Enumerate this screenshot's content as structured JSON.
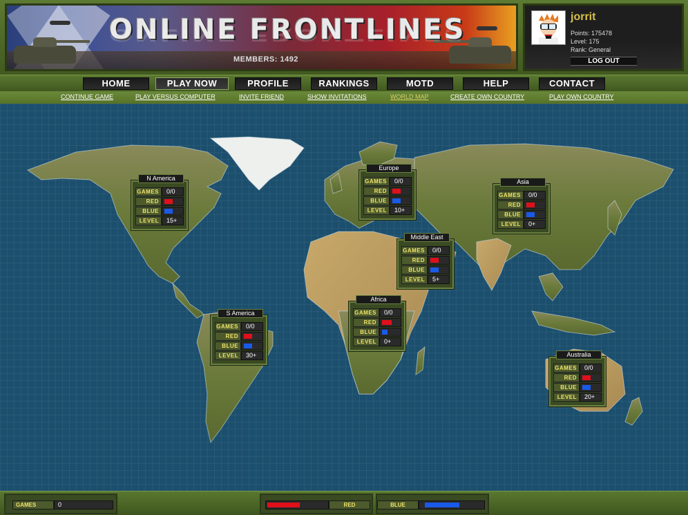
{
  "header": {
    "title": "ONLINE FRONTLINES",
    "members_label": "MEMBERS:",
    "members_count": "1492"
  },
  "user": {
    "name": "jorrit",
    "points": "Points: 175478",
    "level": "Level: 175",
    "rank": "Rank: General",
    "logout": "LOG OUT"
  },
  "nav": {
    "items": [
      {
        "label": "HOME"
      },
      {
        "label": "PLAY NOW",
        "active": true
      },
      {
        "label": "PROFILE"
      },
      {
        "label": "RANKINGS"
      },
      {
        "label": "MOTD"
      },
      {
        "label": "HELP"
      },
      {
        "label": "CONTACT"
      }
    ]
  },
  "subnav": {
    "items": [
      {
        "label": "CONTINUE GAME"
      },
      {
        "label": "PLAY VERSUS COMPUTER"
      },
      {
        "label": "INVITE FRIEND"
      },
      {
        "label": "SHOW INVITATIONS"
      },
      {
        "label": "WORLD MAP",
        "current": true
      },
      {
        "label": "CREATE OWN COUNTRY"
      },
      {
        "label": "PLAY OWN COUNTRY"
      }
    ]
  },
  "row_labels": {
    "games": "GAMES",
    "red": "RED",
    "blue": "BLUE",
    "level": "LEVEL"
  },
  "regions": [
    {
      "name": "N America",
      "games": "0/0",
      "red": 0.45,
      "blue": 0.45,
      "level": "15+"
    },
    {
      "name": "Europe",
      "games": "0/0",
      "red": 0.45,
      "blue": 0.45,
      "level": "10+"
    },
    {
      "name": "Asia",
      "games": "0/0",
      "red": 0.45,
      "blue": 0.45,
      "level": "0+"
    },
    {
      "name": "Middle East",
      "games": "0/0",
      "red": 0.45,
      "blue": 0.45,
      "level": "5+"
    },
    {
      "name": "Africa",
      "games": "0/0",
      "red": 0.55,
      "blue": 0.3,
      "level": "0+"
    },
    {
      "name": "S America",
      "games": "0/0",
      "red": 0.45,
      "blue": 0.45,
      "level": "30+"
    },
    {
      "name": "Australia",
      "games": "0/0",
      "red": 0.45,
      "blue": 0.45,
      "level": "20+"
    }
  ],
  "footer": {
    "games_label": "GAMES",
    "games_value": "0",
    "red_label": "RED",
    "red_fill": 0.55,
    "blue_label": "BLUE",
    "blue_fill": 0.55
  },
  "colors": {
    "red": "#e0101a",
    "blue": "#1a5ae8",
    "accent": "#f0e26a",
    "ocean": "#1c4f6e"
  },
  "icons": {
    "avatar": "avatar-cartoon-icon"
  }
}
